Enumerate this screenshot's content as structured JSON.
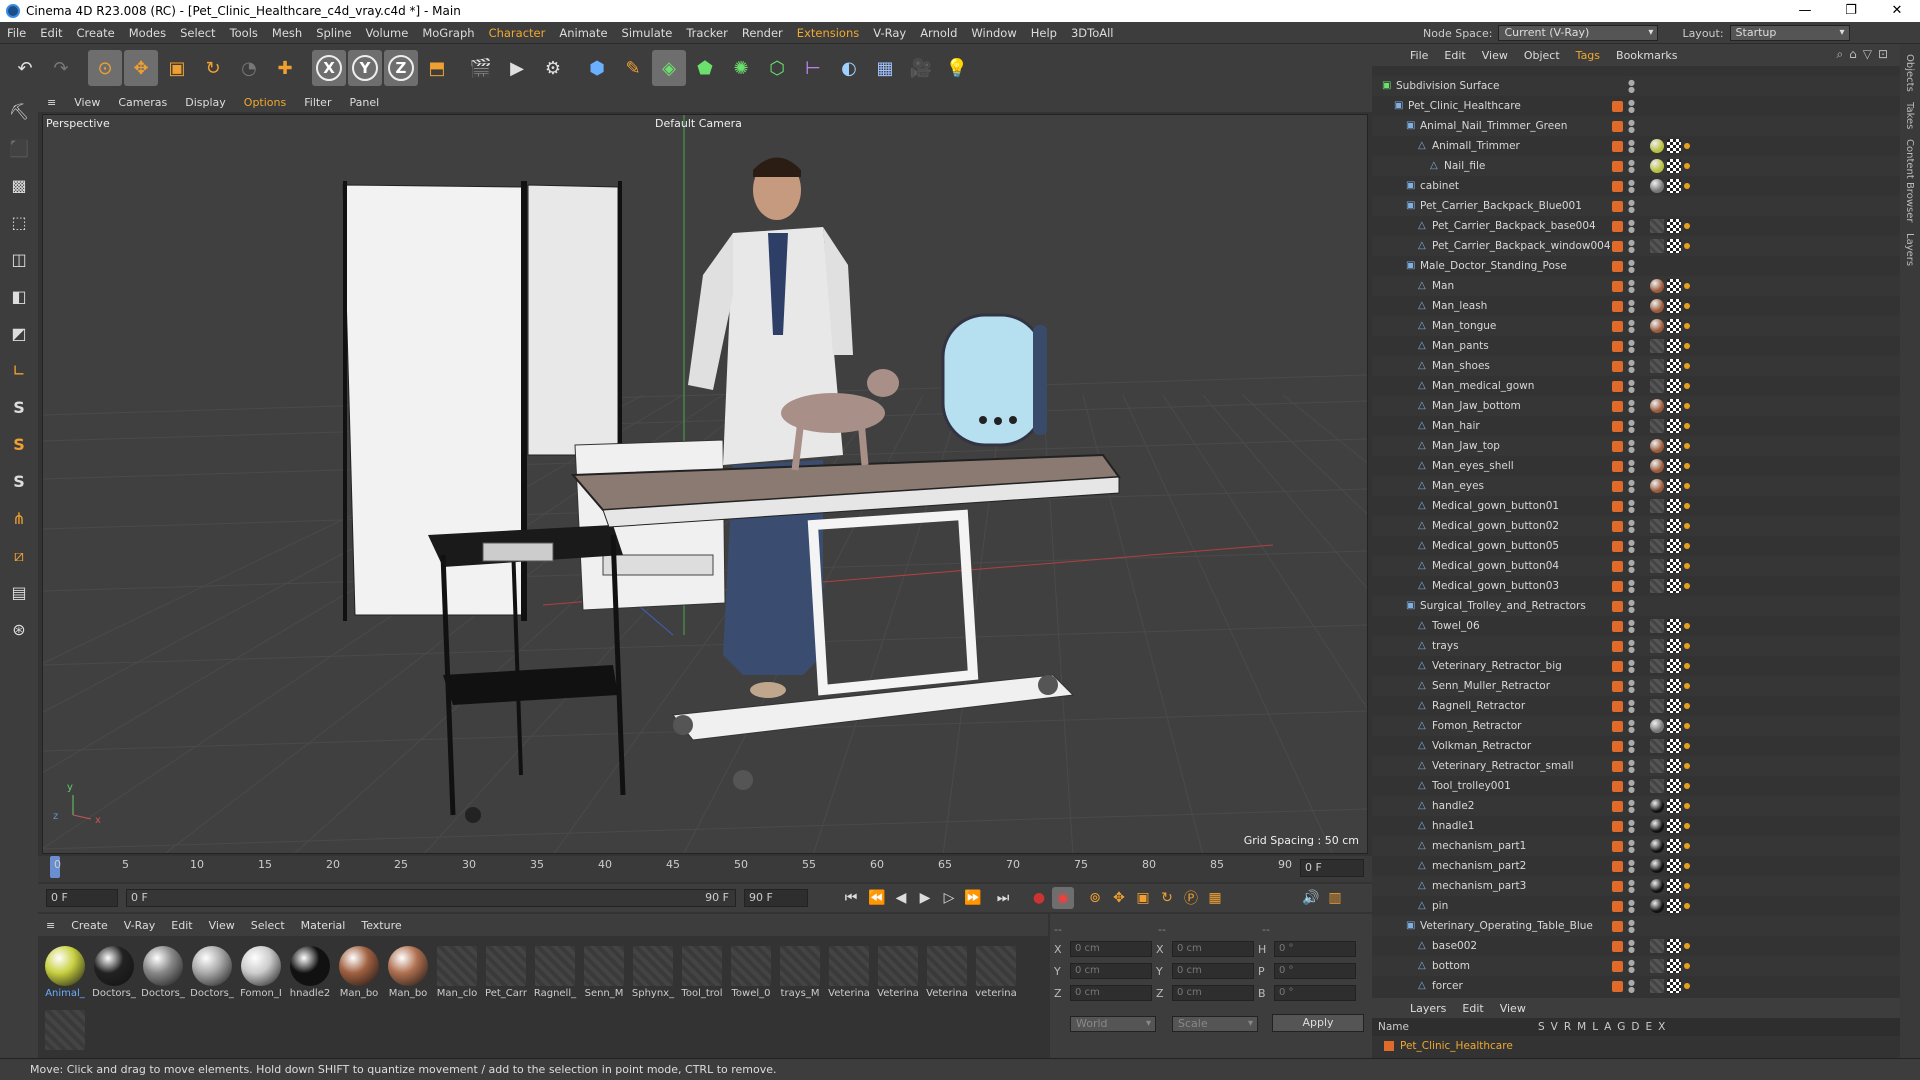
{
  "window": {
    "title": "Cinema 4D R23.008 (RC) - [Pet_Clinic_Healthcare_c4d_vray.c4d *] - Main",
    "controls": [
      "—",
      "❐",
      "✕"
    ]
  },
  "menu": [
    "File",
    "Edit",
    "Create",
    "Modes",
    "Select",
    "Tools",
    "Mesh",
    "Spline",
    "Volume",
    "MoGraph",
    "Character",
    "Animate",
    "Simulate",
    "Tracker",
    "Render",
    "Extensions",
    "V-Ray",
    "Arnold",
    "Window",
    "Help",
    "3DToAll"
  ],
  "nodespace": {
    "label": "Node Space:",
    "value": "Current (V-Ray)",
    "layout_label": "Layout:",
    "layout_value": "Startup"
  },
  "viewport_menu": [
    "View",
    "Cameras",
    "Display",
    "Options",
    "Filter",
    "Panel"
  ],
  "viewport": {
    "name": "Perspective",
    "camera": "Default Camera",
    "grid": "Grid Spacing : 50 cm"
  },
  "timeline": {
    "ticks": [
      "0",
      "5",
      "10",
      "15",
      "20",
      "25",
      "30",
      "35",
      "40",
      "45",
      "50",
      "55",
      "60",
      "65",
      "70",
      "75",
      "80",
      "85",
      "90"
    ],
    "end_field": "0 F"
  },
  "playback": {
    "start": "0 F",
    "current": "0 F",
    "end": "90 F",
    "end2": "90 F"
  },
  "material_menu": [
    "Create",
    "V-Ray",
    "Edit",
    "View",
    "Select",
    "Material",
    "Texture"
  ],
  "materials": [
    {
      "label": "Animal_",
      "color": "#c8d040"
    },
    {
      "label": "Doctors_",
      "color": "#222"
    },
    {
      "label": "Doctors_",
      "color": "#888"
    },
    {
      "label": "Doctors_",
      "color": "#aaa"
    },
    {
      "label": "Fomon_I",
      "color": "#ccc"
    },
    {
      "label": "hnadle2",
      "color": "#111"
    },
    {
      "label": "Man_bo",
      "color": "#a06040"
    },
    {
      "label": "Man_bo",
      "color": "#b07050"
    },
    {
      "label": "Man_clo",
      "color": ""
    },
    {
      "label": "Pet_Carr",
      "color": ""
    },
    {
      "label": "Ragnell_",
      "color": ""
    },
    {
      "label": "Senn_M",
      "color": ""
    },
    {
      "label": "Sphynx_",
      "color": ""
    },
    {
      "label": "Tool_trol",
      "color": ""
    },
    {
      "label": "Towel_0",
      "color": ""
    },
    {
      "label": "trays_M",
      "color": ""
    },
    {
      "label": "Veterina",
      "color": ""
    },
    {
      "label": "Veterina",
      "color": ""
    },
    {
      "label": "Veterina",
      "color": ""
    },
    {
      "label": "veterina",
      "color": ""
    }
  ],
  "coords": {
    "x": "0 cm",
    "y": "0 cm",
    "z": "0 cm",
    "x2": "0 cm",
    "y2": "0 cm",
    "z2": "0 cm",
    "h": "0 °",
    "p": "0 °",
    "b": "0 °",
    "sys": "World",
    "mode": "Scale",
    "apply": "Apply",
    "head1": "--",
    "head2": "--",
    "head3": "--"
  },
  "object_menu": [
    "File",
    "Edit",
    "View",
    "Object",
    "Tags",
    "Bookmarks"
  ],
  "objects": [
    {
      "name": "Subdivision Surface",
      "d": 0,
      "t": ""
    },
    {
      "name": "Pet_Clinic_Healthcare",
      "d": 1,
      "t": ""
    },
    {
      "name": "Animal_Nail_Trimmer_Green",
      "d": 2,
      "t": ""
    },
    {
      "name": "Animall_Trimmer",
      "d": 3,
      "t": "g"
    },
    {
      "name": "Nail_file",
      "d": 4,
      "t": "g"
    },
    {
      "name": "cabinet",
      "d": 2,
      "t": "s"
    },
    {
      "name": "Pet_Carrier_Backpack_Blue001",
      "d": 2,
      "t": ""
    },
    {
      "name": "Pet_Carrier_Backpack_base004",
      "d": 3,
      "t": "c"
    },
    {
      "name": "Pet_Carrier_Backpack_window004",
      "d": 3,
      "t": "c"
    },
    {
      "name": "Male_Doctor_Standing_Pose",
      "d": 2,
      "t": ""
    },
    {
      "name": "Man",
      "d": 3,
      "t": "b"
    },
    {
      "name": "Man_leash",
      "d": 3,
      "t": "b"
    },
    {
      "name": "Man_tongue",
      "d": 3,
      "t": "b"
    },
    {
      "name": "Man_pants",
      "d": 3,
      "t": "c"
    },
    {
      "name": "Man_shoes",
      "d": 3,
      "t": "c"
    },
    {
      "name": "Man_medical_gown",
      "d": 3,
      "t": "c"
    },
    {
      "name": "Man_Jaw_bottom",
      "d": 3,
      "t": "b"
    },
    {
      "name": "Man_hair",
      "d": 3,
      "t": "c"
    },
    {
      "name": "Man_Jaw_top",
      "d": 3,
      "t": "b"
    },
    {
      "name": "Man_eyes_shell",
      "d": 3,
      "t": "b"
    },
    {
      "name": "Man_eyes",
      "d": 3,
      "t": "b"
    },
    {
      "name": "Medical_gown_button01",
      "d": 3,
      "t": "c"
    },
    {
      "name": "Medical_gown_button02",
      "d": 3,
      "t": "c"
    },
    {
      "name": "Medical_gown_button05",
      "d": 3,
      "t": "c"
    },
    {
      "name": "Medical_gown_button04",
      "d": 3,
      "t": "c"
    },
    {
      "name": "Medical_gown_button03",
      "d": 3,
      "t": "c"
    },
    {
      "name": "Surgical_Trolley_and_Retractors",
      "d": 2,
      "t": ""
    },
    {
      "name": "Towel_06",
      "d": 3,
      "t": "c"
    },
    {
      "name": "trays",
      "d": 3,
      "t": "c"
    },
    {
      "name": "Veterinary_Retractor_big",
      "d": 3,
      "t": "c"
    },
    {
      "name": "Senn_Muller_Retractor",
      "d": 3,
      "t": "c"
    },
    {
      "name": "Ragnell_Retractor",
      "d": 3,
      "t": "c"
    },
    {
      "name": "Fomon_Retractor",
      "d": 3,
      "t": "s"
    },
    {
      "name": "Volkman_Retractor",
      "d": 3,
      "t": "c"
    },
    {
      "name": "Veterinary_Retractor_small",
      "d": 3,
      "t": "c"
    },
    {
      "name": "Tool_trolley001",
      "d": 3,
      "t": "c"
    },
    {
      "name": "handle2",
      "d": 3,
      "t": "k"
    },
    {
      "name": "hnadle1",
      "d": 3,
      "t": "k"
    },
    {
      "name": "mechanism_part1",
      "d": 3,
      "t": "k"
    },
    {
      "name": "mechanism_part2",
      "d": 3,
      "t": "k"
    },
    {
      "name": "mechanism_part3",
      "d": 3,
      "t": "k"
    },
    {
      "name": "pin",
      "d": 3,
      "t": "k"
    },
    {
      "name": "Veterinary_Operating_Table_Blue",
      "d": 2,
      "t": ""
    },
    {
      "name": "base002",
      "d": 3,
      "t": "c"
    },
    {
      "name": "bottom",
      "d": 3,
      "t": "c"
    },
    {
      "name": "forcer",
      "d": 3,
      "t": "c"
    }
  ],
  "layers": {
    "menu": [
      "Layers",
      "Edit",
      "View"
    ],
    "name_col": "Name",
    "flags": [
      "S",
      "V",
      "R",
      "M",
      "L",
      "A",
      "G",
      "D",
      "E",
      "X"
    ],
    "row": "Pet_Clinic_Healthcare"
  },
  "side_tabs": [
    "Objects",
    "Takes",
    "Content Browser",
    "Layers"
  ],
  "status": "Move: Click and drag to move elements. Hold down SHIFT to quantize movement / add to the selection in point mode, CTRL to remove."
}
